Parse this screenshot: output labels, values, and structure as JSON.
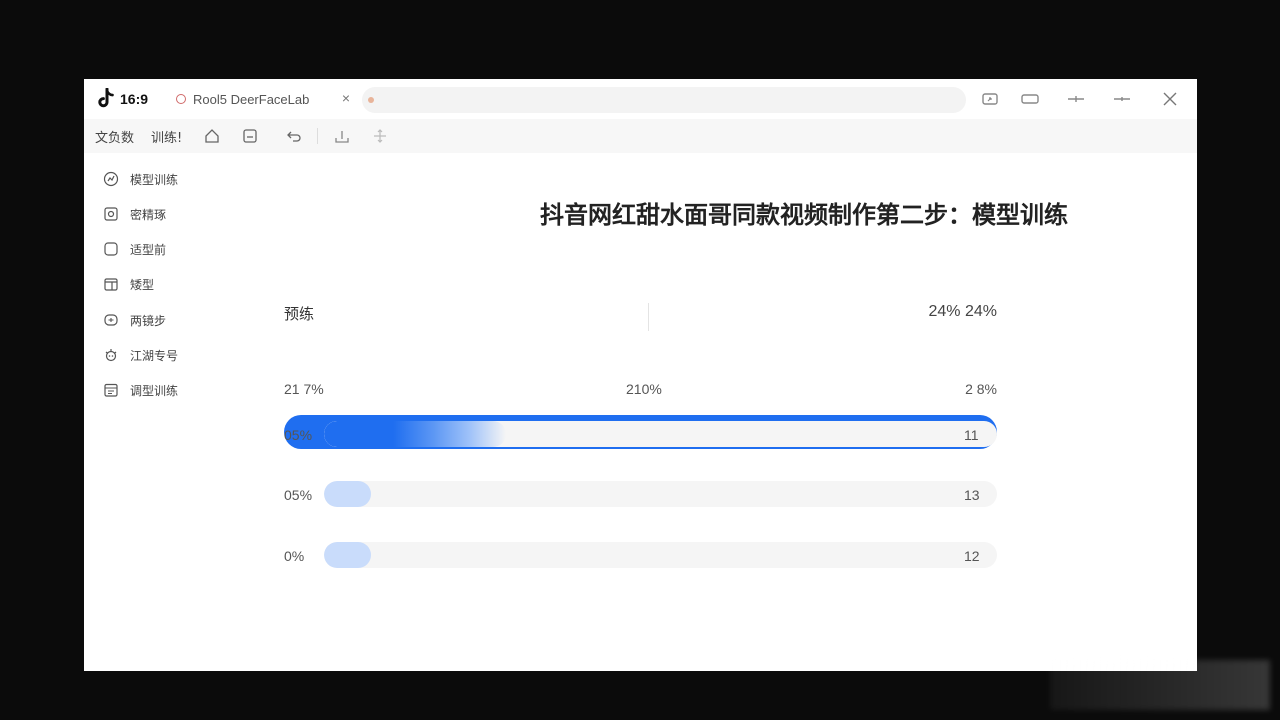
{
  "titlebar": {
    "ratio": "16:9",
    "tab_title": "Rool5 DeerFaceLab",
    "tab_close": "×"
  },
  "toolbar": {
    "menu1": "文负数",
    "menu2": "训练!"
  },
  "sidebar": {
    "items": [
      {
        "label": "模型训练",
        "icon": "chart-icon"
      },
      {
        "label": "密精琢",
        "icon": "image-icon"
      },
      {
        "label": "适型前",
        "icon": "square-icon"
      },
      {
        "label": "矮型",
        "icon": "box-icon"
      },
      {
        "label": "两镜步",
        "icon": "face-icon"
      },
      {
        "label": "江湖专号",
        "icon": "gear-icon"
      },
      {
        "label": "调型训练",
        "icon": "calendar-icon"
      }
    ]
  },
  "main": {
    "heading": "抖音网红甜水面哥同款视频制作第二步：模型训练",
    "section_label": "预练",
    "top_right": "24%  24%",
    "main_progress": 1.0,
    "scale_left": "21 7%",
    "scale_mid": "210%",
    "scale_right": "2 8%",
    "rows": [
      {
        "pct": "05%",
        "value": "11",
        "fill": 0.27
      },
      {
        "pct": "05%",
        "value": "13",
        "fill": 0.07
      },
      {
        "pct": "0%",
        "value": "12",
        "fill": 0.07
      }
    ]
  },
  "colors": {
    "accent": "#1f6ef0",
    "light_accent": "#c9dcfb",
    "background": "#0b0b0b"
  }
}
